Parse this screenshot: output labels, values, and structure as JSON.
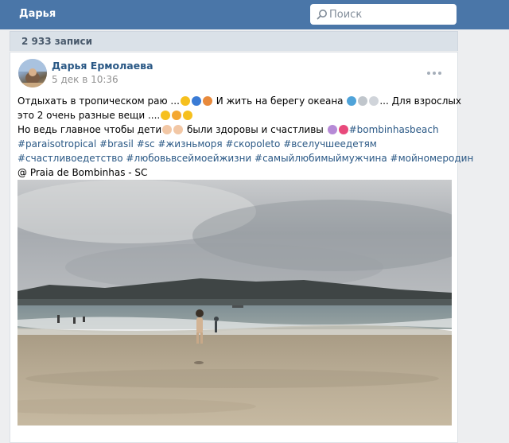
{
  "header": {
    "title": "Дарья",
    "search_placeholder": "Поиск"
  },
  "wall": {
    "count_label": "2 933 записи"
  },
  "post": {
    "author": "Дарья Ермолаева",
    "date": "5 дек в 10:36",
    "lines": [
      [
        {
          "t": "Отдыхать в тропическом раю ..."
        },
        {
          "e": [
            "#f6c01e",
            "#3a7bd5",
            "#e88a3c"
          ]
        },
        {
          "t": " И жить на берегу океана "
        },
        {
          "e": [
            "#4fa3d9",
            "#c0c6cc",
            "#d0d4da"
          ]
        },
        {
          "t": "... Для взрослых"
        }
      ],
      [
        {
          "t": "это 2 очень разные вещи ...."
        },
        {
          "e": [
            "#f6c01e",
            "#f4a731",
            "#f6c01e"
          ]
        }
      ],
      [
        {
          "t": "Но ведь главное чтобы дети"
        },
        {
          "e": [
            "#f2c7a5",
            "#f2c7a5"
          ]
        },
        {
          "t": " были здоровы и счастливы "
        },
        {
          "e": [
            "#b68ad6",
            "#e8497b"
          ]
        },
        {
          "tag": "#bombinhasbeach"
        }
      ],
      [
        {
          "tag": "#paraisotropical #brasil #sc #жизньморя #скороleto #вселучшеедетям"
        }
      ],
      [
        {
          "tag": "#счастливоедетство #любовьвсеймоейжизни #самыйлюбимыймужчина #мойномеродин"
        }
      ],
      [
        {
          "t": "@ Praia de Bombinhas - SC"
        }
      ]
    ]
  },
  "icons": {
    "search": "search-icon",
    "more": "more-options-icon"
  }
}
